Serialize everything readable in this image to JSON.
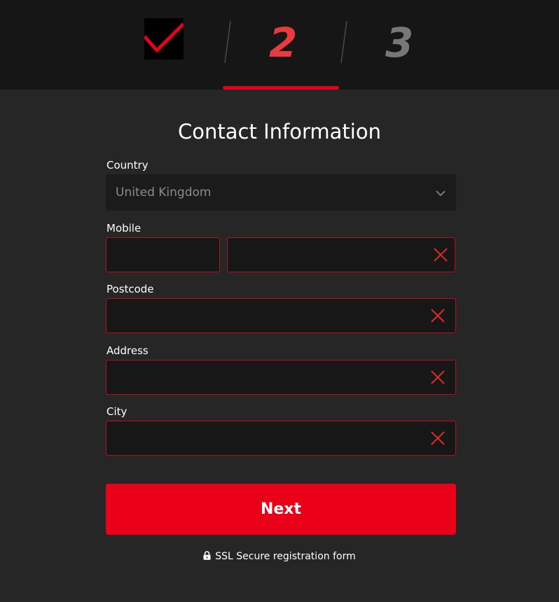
{
  "stepper": {
    "step2": "2",
    "step3": "3"
  },
  "form": {
    "title": "Contact Information",
    "country_label": "Country",
    "country_value": "United Kingdom",
    "mobile_label": "Mobile",
    "mobile_prefix_value": "",
    "mobile_number_value": "",
    "postcode_label": "Postcode",
    "postcode_value": "",
    "address_label": "Address",
    "address_value": "",
    "city_label": "City",
    "city_value": ""
  },
  "actions": {
    "next_label": "Next"
  },
  "footer": {
    "ssl_text": "SSL Secure registration form"
  },
  "colors": {
    "accent": "#ea0019",
    "error_border": "#b5101c",
    "background": "#262626",
    "header_bg": "#161616"
  },
  "icons": {
    "completed_step": "checkmark-icon",
    "dropdown": "chevron-down-icon",
    "field_error": "close-icon",
    "ssl": "lock-icon"
  }
}
